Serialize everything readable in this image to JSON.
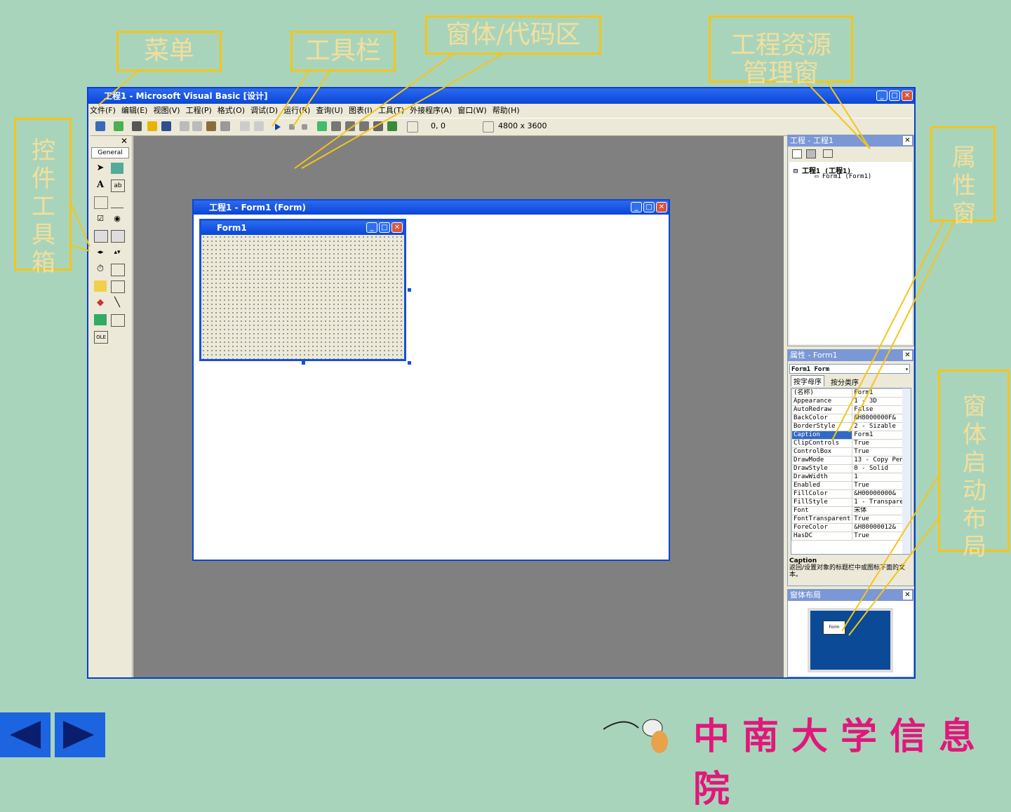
{
  "callouts": {
    "menu": "菜单",
    "toolbar": "工具栏",
    "form_code": "窗体/代码区",
    "project_explorer": "工程资源管理窗",
    "toolbox": "控件工具箱",
    "properties": "属性窗",
    "form_layout": "窗体启动布局"
  },
  "window": {
    "title": "工程1 - Microsoft Visual Basic [设计]"
  },
  "menubar": {
    "items": [
      "文件(F)",
      "编辑(E)",
      "视图(V)",
      "工程(P)",
      "格式(O)",
      "调试(D)",
      "运行(R)",
      "查询(U)",
      "图表(I)",
      "工具(T)",
      "外接程序(A)",
      "窗口(W)",
      "帮助(H)"
    ]
  },
  "toolbar": {
    "position": "0, 0",
    "size": "4800 x 3600"
  },
  "toolbox": {
    "tab": "General"
  },
  "designer": {
    "title": "工程1 - Form1 (Form)",
    "form_caption": "Form1"
  },
  "project": {
    "title": "工程 - 工程1",
    "root": "工程1 (工程1)",
    "child": "Form1 (Form1)"
  },
  "properties": {
    "title": "属性 - Form1",
    "object": "Form1 Form",
    "tab_alpha": "按字母序",
    "tab_category": "按分类序",
    "rows": [
      {
        "name": "(名称)",
        "value": "Form1"
      },
      {
        "name": "Appearance",
        "value": "1 - 3D"
      },
      {
        "name": "AutoRedraw",
        "value": "False"
      },
      {
        "name": "BackColor",
        "value": "&H8000000F&"
      },
      {
        "name": "BorderStyle",
        "value": "2 - Sizable"
      },
      {
        "name": "Caption",
        "value": "Form1"
      },
      {
        "name": "ClipControls",
        "value": "True"
      },
      {
        "name": "ControlBox",
        "value": "True"
      },
      {
        "name": "DrawMode",
        "value": "13 - Copy Pen"
      },
      {
        "name": "DrawStyle",
        "value": "0 - Solid"
      },
      {
        "name": "DrawWidth",
        "value": "1"
      },
      {
        "name": "Enabled",
        "value": "True"
      },
      {
        "name": "FillColor",
        "value": "&H00000000&"
      },
      {
        "name": "FillStyle",
        "value": "1 - Transparent"
      },
      {
        "name": "Font",
        "value": "宋体"
      },
      {
        "name": "FontTransparent",
        "value": "True"
      },
      {
        "name": "ForeColor",
        "value": "&H80000012&"
      },
      {
        "name": "HasDC",
        "value": "True"
      }
    ],
    "desc_title": "Caption",
    "desc_text": "返回/设置对象的标题栏中或图标下面的文本。"
  },
  "layout": {
    "title": "窗体布局",
    "mini_form": "Form"
  },
  "footer": {
    "brand": "中南大学信息院"
  }
}
